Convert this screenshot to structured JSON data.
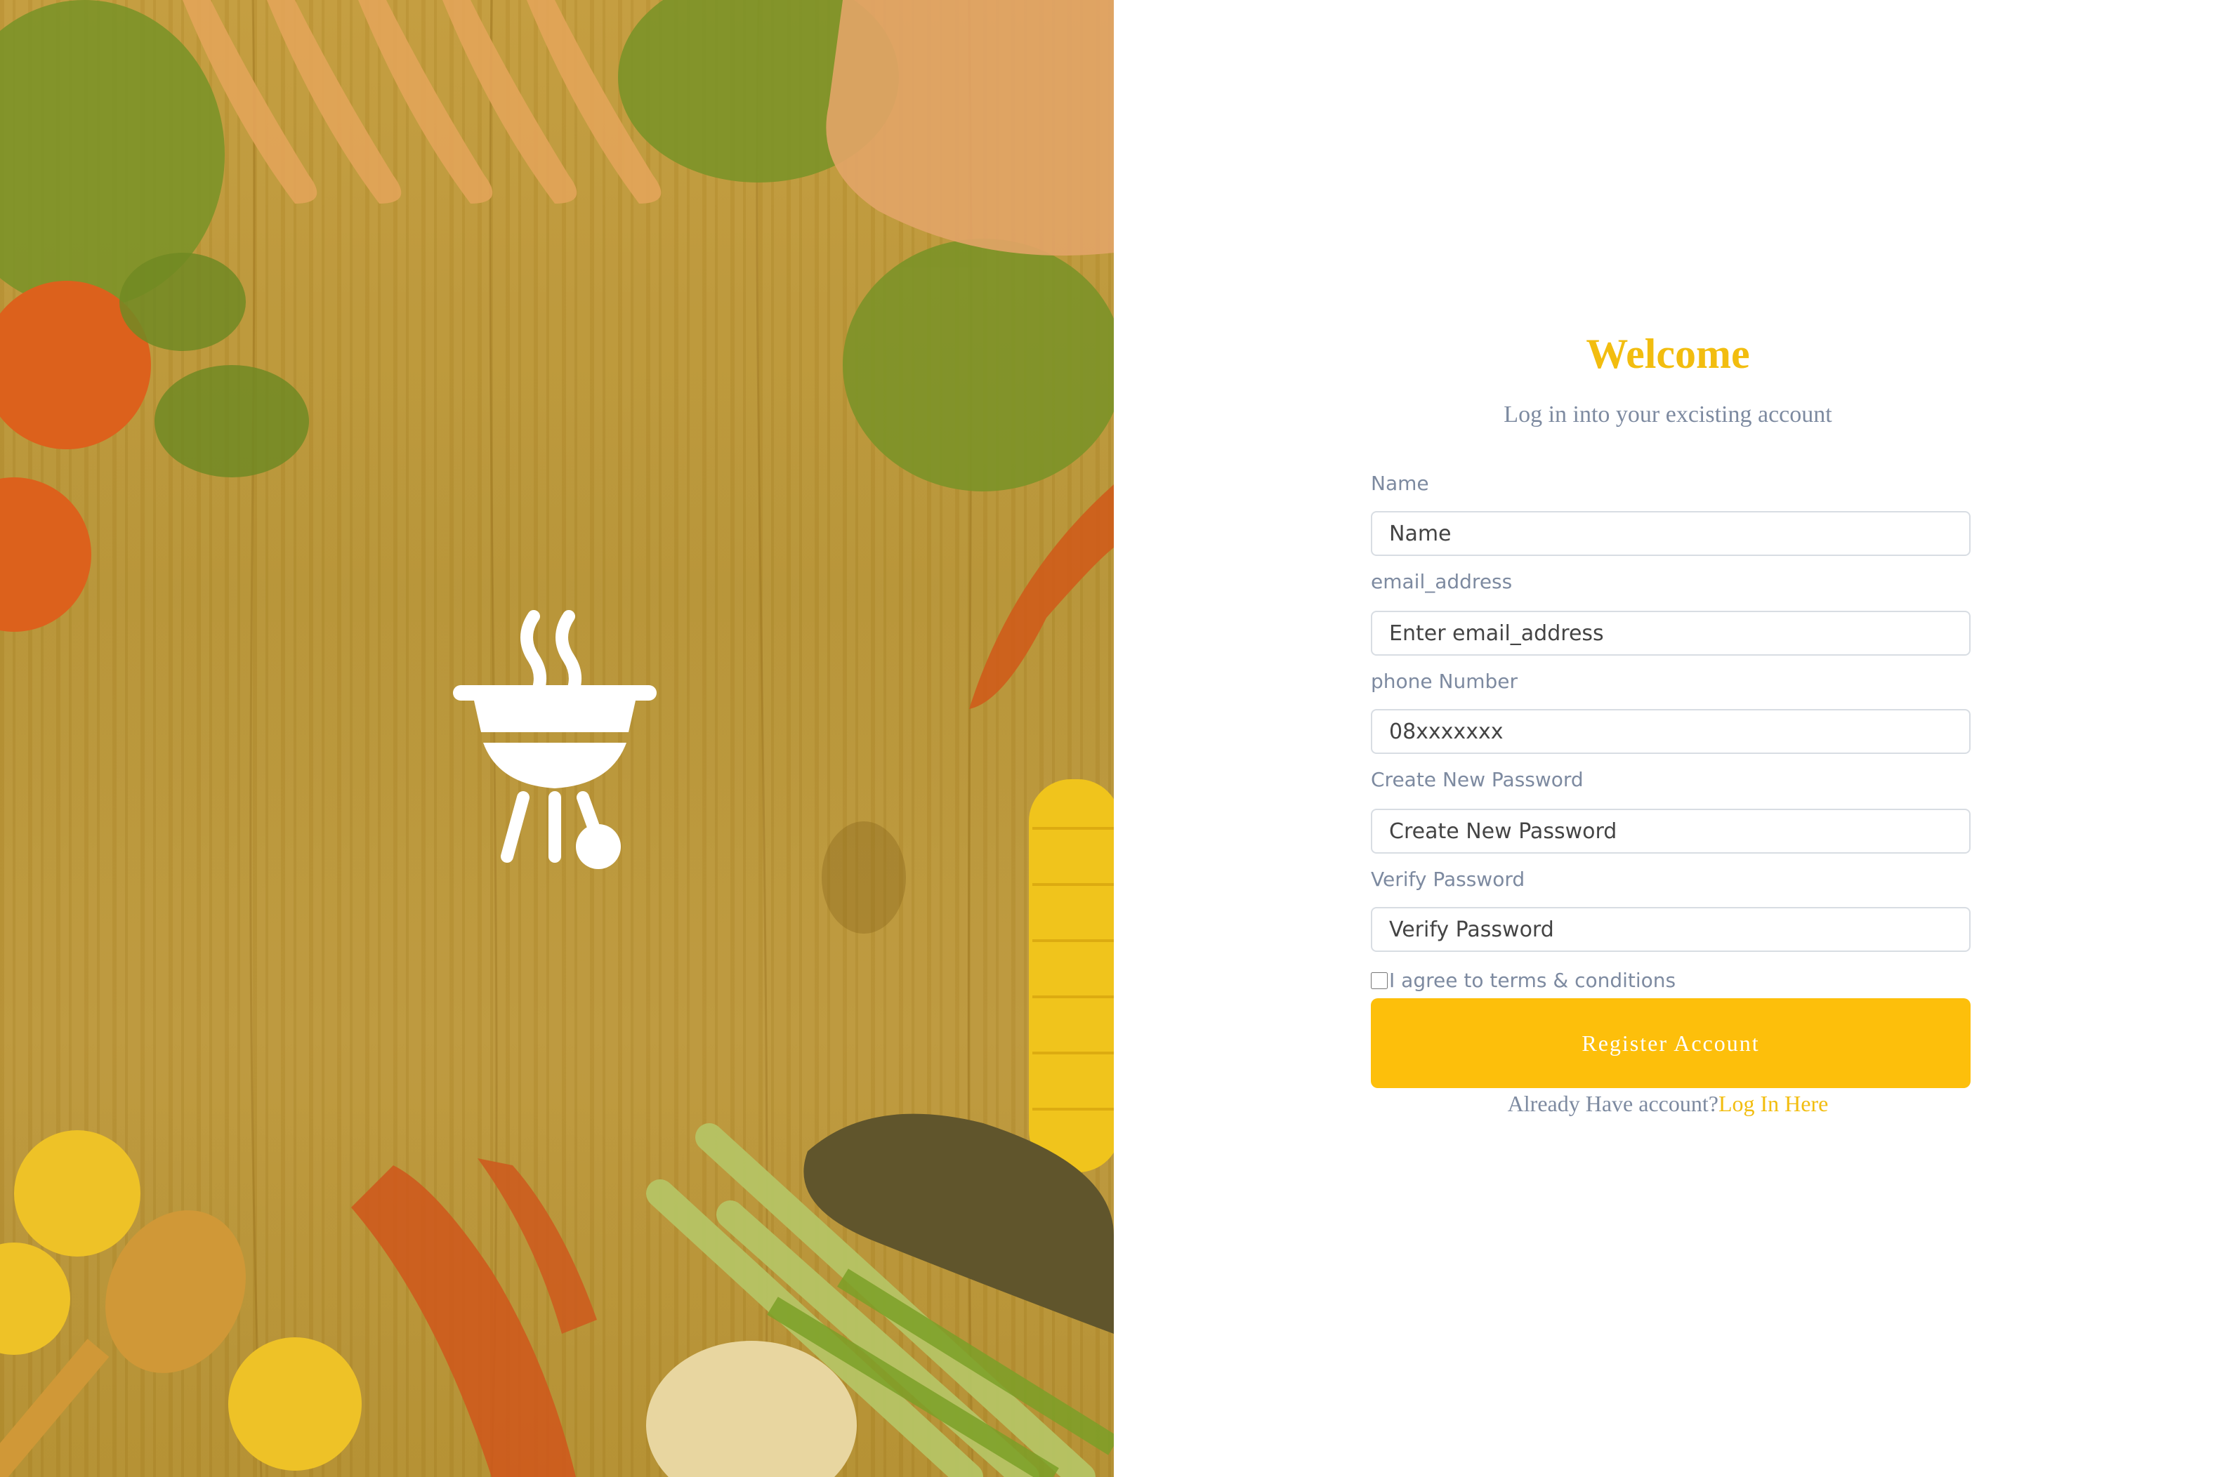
{
  "hero": {
    "icon": "grill-icon"
  },
  "header": {
    "title": "Welcome",
    "subtitle": "Log in into your excisting account"
  },
  "form": {
    "fields": [
      {
        "label": "Name",
        "placeholder": "Name",
        "value": ""
      },
      {
        "label": "email_address",
        "placeholder": "Enter email_address",
        "value": ""
      },
      {
        "label": "phone Number",
        "placeholder": "08xxxxxxx",
        "value": ""
      },
      {
        "label": "Create New Password",
        "placeholder": "Create New Password",
        "value": ""
      },
      {
        "label": "Verify Password",
        "placeholder": "Verify Password",
        "value": ""
      }
    ],
    "terms_label": "I agree to terms & conditions",
    "submit_label": "Register Account",
    "login_prompt": "Already Have account?",
    "login_link": "Log In Here"
  },
  "colors": {
    "accent": "#fdbf0b",
    "heading": "#f2bd0f",
    "muted_text": "#7d8aa0"
  }
}
